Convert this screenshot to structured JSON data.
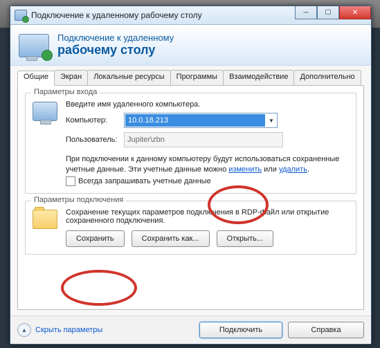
{
  "window": {
    "title": "Подключение к удаленному рабочему столу"
  },
  "header": {
    "line1": "Подключение к удаленному",
    "line2": "рабочему столу"
  },
  "tabs": {
    "t0": "Общие",
    "t1": "Экран",
    "t2": "Локальные ресурсы",
    "t3": "Программы",
    "t4": "Взаимодействие",
    "t5": "Дополнительно"
  },
  "login_group": {
    "legend": "Параметры входа",
    "intro": "Введите имя удаленного компьютера.",
    "computer_label": "Компьютер:",
    "computer_value": "10.0.18.213",
    "user_label": "Пользователь:",
    "user_value": "Jupiter\\zbn",
    "cred_part1": "При подключении к данному компьютеру будут использоваться сохраненные учетные данные. Эти учетные данные можно ",
    "link_change": "изменить",
    "cred_sep": " или ",
    "link_delete": "удалить",
    "cred_end": ".",
    "always_ask": "Всегда запрашивать учетные данные"
  },
  "conn_group": {
    "legend": "Параметры подключения",
    "desc": "Сохранение текущих параметров подключения в RDP-файл или открытие сохраненного подключения.",
    "save": "Сохранить",
    "save_as": "Сохранить как...",
    "open": "Открыть..."
  },
  "footer": {
    "hide": "Скрыть параметры",
    "connect": "Подключить",
    "help": "Справка"
  }
}
